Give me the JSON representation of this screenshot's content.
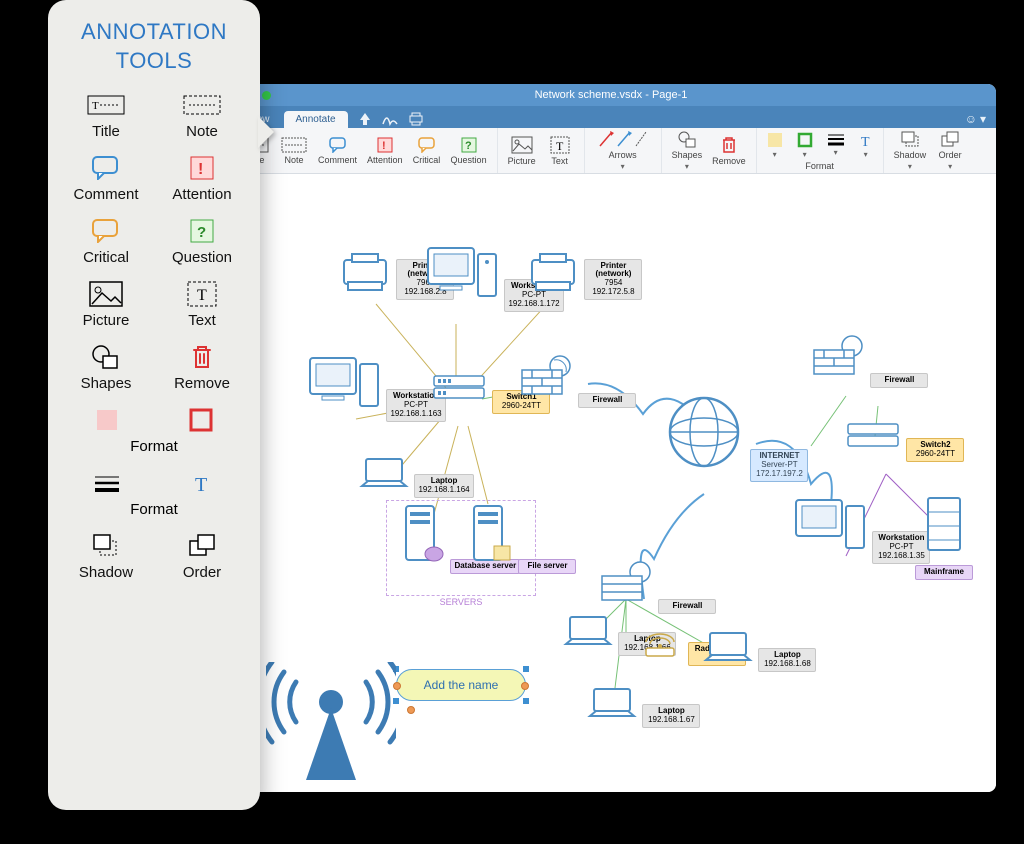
{
  "promo": {
    "title": "ANNOTATION\nTOOLS",
    "items": {
      "title": "Title",
      "note": "Note",
      "comment": "Comment",
      "attention": "Attention",
      "critical": "Critical",
      "question": "Question",
      "picture": "Picture",
      "text": "Text",
      "shapes": "Shapes",
      "remove": "Remove",
      "format": "Format",
      "shadow": "Shadow",
      "order": "Order"
    }
  },
  "app": {
    "window_title": "Network scheme.vsdx - Page-1",
    "tabs": {
      "view": "View",
      "annotate": "Annotate"
    },
    "smile_menu": "☺"
  },
  "ribbon": {
    "title": "Title",
    "note": "Note",
    "comment": "Comment",
    "attention": "Attention",
    "critical": "Critical",
    "question": "Question",
    "picture": "Picture",
    "text": "Text",
    "arrows": "Arrows",
    "shapes": "Shapes",
    "remove": "Remove",
    "format": "Format",
    "shadow": "Shadow",
    "order": "Order"
  },
  "diagram": {
    "printer1": {
      "name": "Printer\n(network)",
      "host": "7960",
      "ip": "192.168.2.8"
    },
    "printer2": {
      "name": "Printer\n(network)",
      "host": "7954",
      "ip": "192.172.5.8"
    },
    "ws1": {
      "name": "Workstation",
      "host": "PC-PT",
      "ip": "192.168.1.172"
    },
    "ws2": {
      "name": "Workstation",
      "host": "PC-PT",
      "ip": "192.168.1.163"
    },
    "ws3": {
      "name": "Workstation",
      "host": "PC-PT",
      "ip": "192.168.1.35"
    },
    "laptop1": {
      "name": "Laptop",
      "ip": "192.168.1.164"
    },
    "laptop2": {
      "name": "Laptop",
      "ip": "192.168.1.66"
    },
    "laptop3": {
      "name": "Laptop",
      "ip": "192.168.1.67"
    },
    "laptop4": {
      "name": "Laptop",
      "ip": "192.168.1.68"
    },
    "switch1": {
      "name": "Switch1",
      "model": "2960-24TT"
    },
    "switch2": {
      "name": "Switch2",
      "model": "2960-24TT"
    },
    "firewall": {
      "name": "Firewall"
    },
    "internet": {
      "name": "INTERNET",
      "host": "Server-PT",
      "ip": "172.17.197.2"
    },
    "mainframe": {
      "name": "Mainframe"
    },
    "dbserver": {
      "name": "Database server"
    },
    "fileserver": {
      "name": "File server"
    },
    "radiorouter": {
      "name": "Radiorouter",
      "model": "2811"
    },
    "servers_group": "SERVERS",
    "callout_text": "Add the name"
  }
}
